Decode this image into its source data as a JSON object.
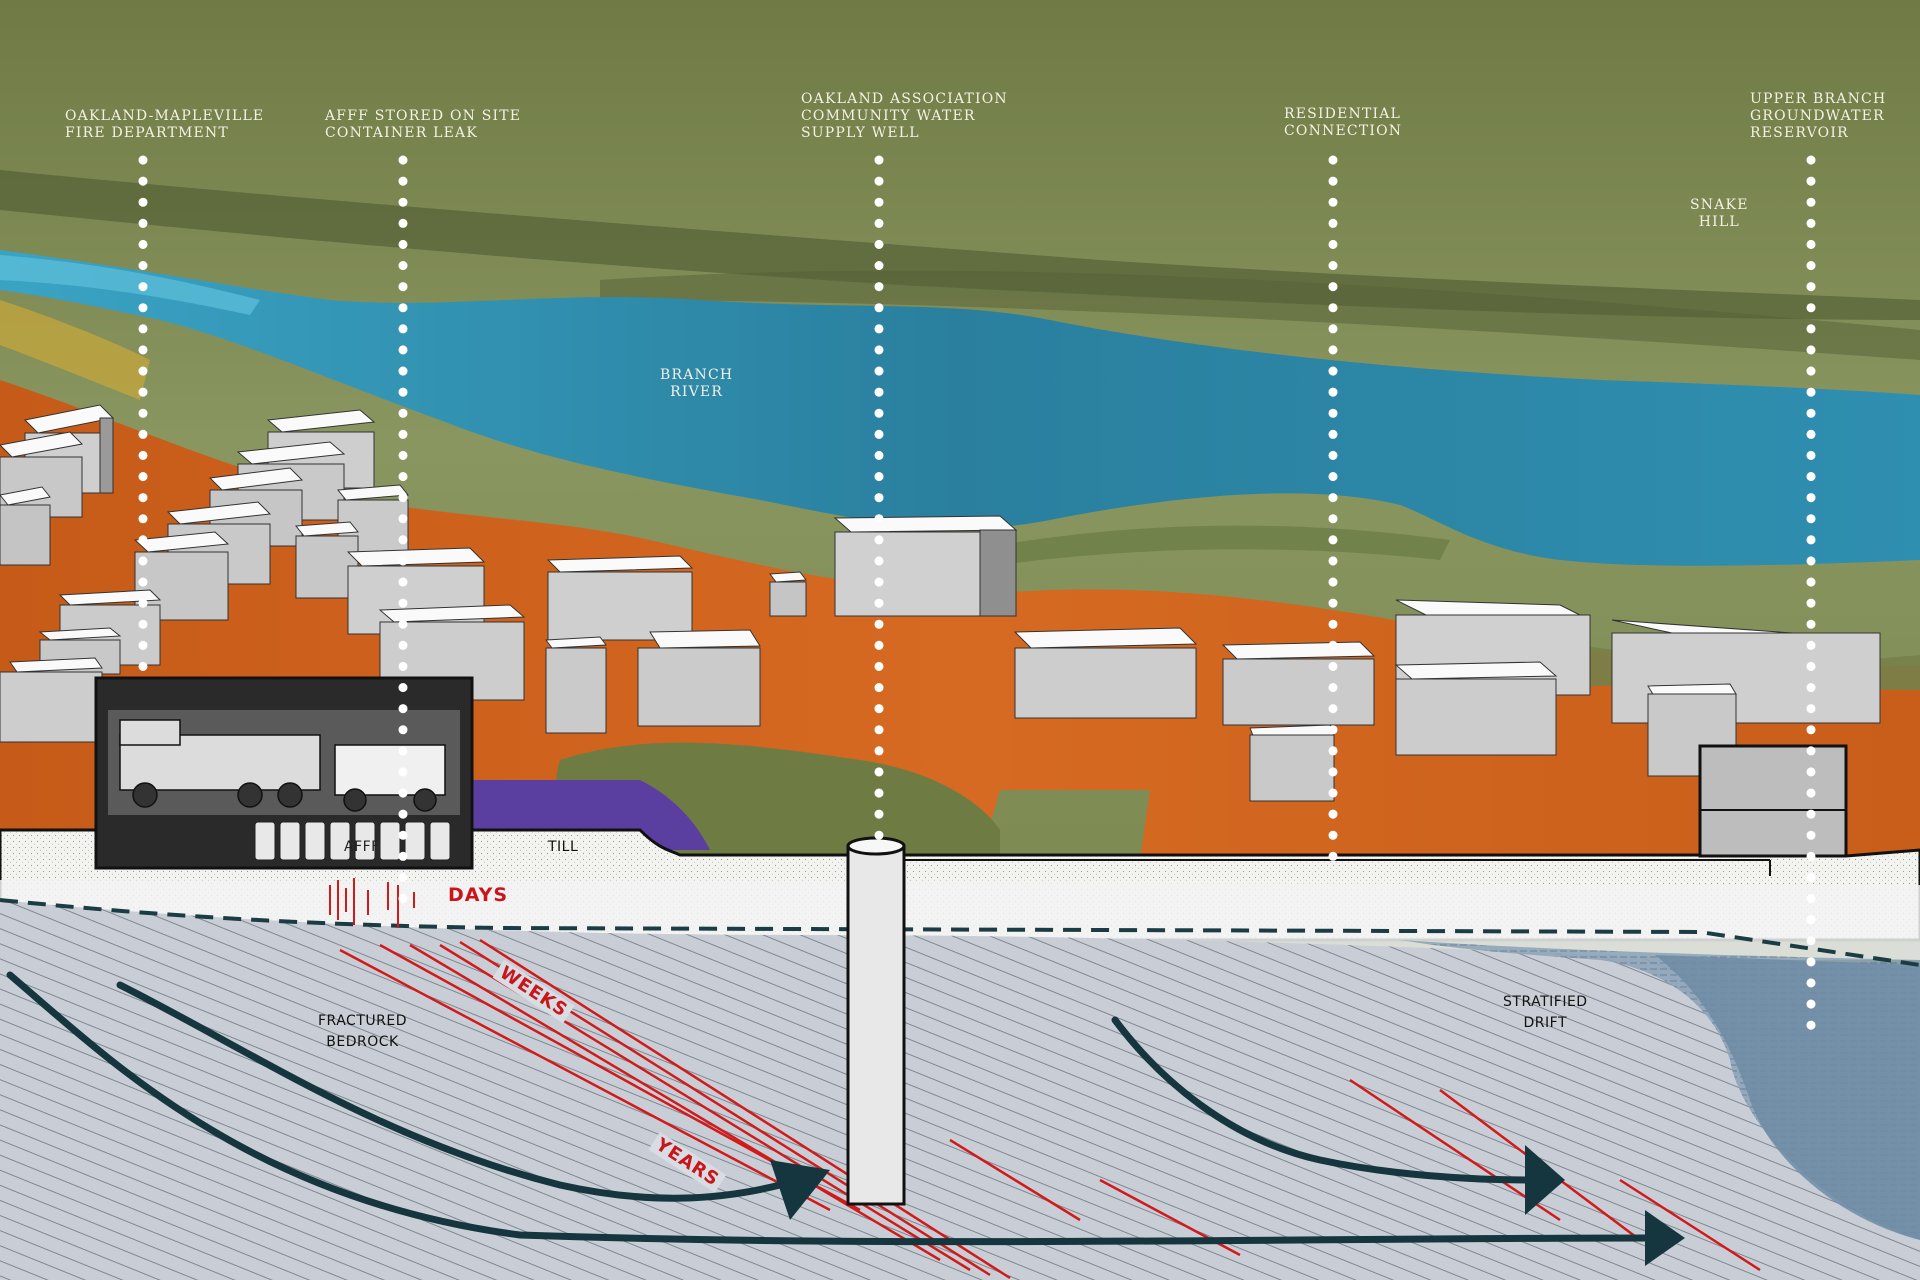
{
  "callouts": {
    "fire_department": "OAKLAND-MAPLEVILLE\nFIRE DEPARTMENT",
    "affe_leak": "AFFF STORED ON SITE\nCONTAINER LEAK",
    "supply_well": "OAKLAND ASSOCIATION\nCOMMUNITY WATER\nSUPPLY WELL",
    "residential": "RESIDENTIAL\nCONNECTION",
    "reservoir": "UPPER BRANCH\nGROUNDWATER\nRESERVOIR"
  },
  "places": {
    "snake_hill": "SNAKE\nHILL",
    "branch_river": "BRANCH\nRIVER"
  },
  "geology": {
    "affe": "AFFF",
    "till": "TILL",
    "fractured_bedrock": "FRACTURED\nBEDROCK",
    "stratified_drift": "STRATIFIED\nDRIFT"
  },
  "timescales": {
    "days": "DAYS",
    "weeks": "WEEKS",
    "years": "YEARS"
  },
  "colors": {
    "terrain_green": "#74804a",
    "river_blue": "#2f8fb0",
    "soil_orange": "#d0621c",
    "purple": "#5a3ea0",
    "bedrock": "#c9ced6",
    "drift_blue": "#7f98ad",
    "flow_arrow": "#16363f",
    "contaminant_red": "#d11a1a"
  }
}
